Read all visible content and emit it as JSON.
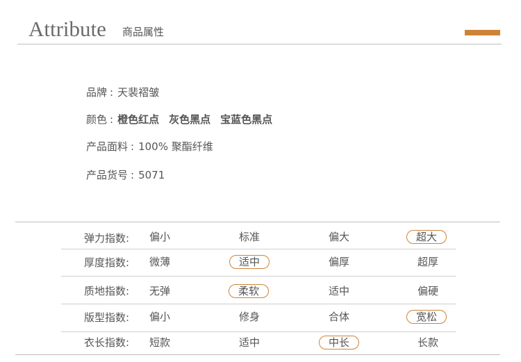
{
  "header": {
    "title": "Attribute",
    "subtitle": "商品属性",
    "accent_color": "#cd8436"
  },
  "attributes": [
    {
      "label": "品牌",
      "values": [
        "天裴褶皱"
      ],
      "bold": false
    },
    {
      "label": "颜色",
      "values": [
        "橙色红点",
        "灰色黑点",
        "宝蓝色黑点"
      ],
      "bold": true
    },
    {
      "label": "产品面料",
      "values": [
        "100% 聚酯纤维"
      ],
      "bold": false
    },
    {
      "label": "产品货号",
      "values": [
        "5071"
      ],
      "bold": false
    }
  ],
  "indexes": [
    {
      "label": "弹力指数:",
      "options": [
        "偏小",
        "标准",
        "偏大",
        "超大"
      ],
      "selected": 3
    },
    {
      "label": "厚度指数:",
      "options": [
        "微薄",
        "适中",
        "偏厚",
        "超厚"
      ],
      "selected": 1
    },
    {
      "label": "质地指数:",
      "options": [
        "无弹",
        "柔软",
        "适中",
        "偏硬"
      ],
      "selected": 1
    },
    {
      "label": "版型指数:",
      "options": [
        "偏小",
        "修身",
        "合体",
        "宽松"
      ],
      "selected": 3
    },
    {
      "label": "衣长指数:",
      "options": [
        "短款",
        "适中",
        "中长",
        "长款"
      ],
      "selected": 2
    }
  ]
}
